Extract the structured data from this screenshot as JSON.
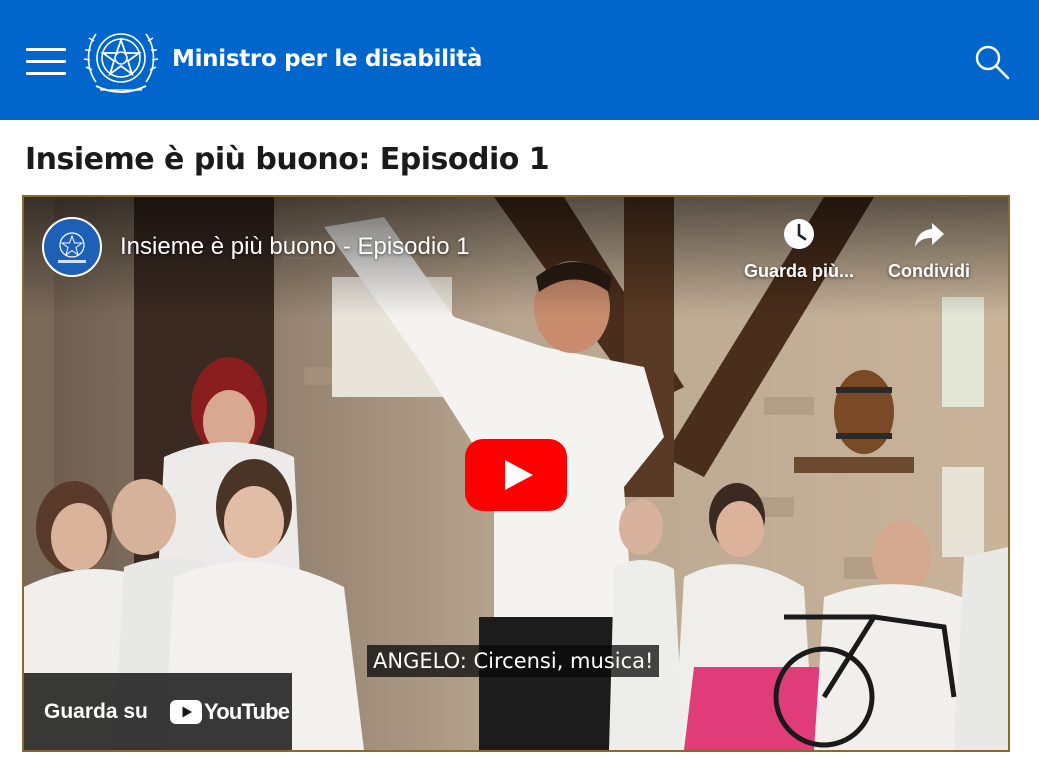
{
  "header": {
    "site_title": "Ministro per le disabilità",
    "menu_icon": "hamburger-menu-icon",
    "search_icon": "search-icon",
    "background_color": "#0066cc"
  },
  "page": {
    "title": "Insieme è più buono: Episodio 1"
  },
  "video": {
    "title": "Insieme è più buono - Episodio 1",
    "watch_later_label": "Guarda più...",
    "share_label": "Condividi",
    "caption": "ANGELO: Circensi, musica!",
    "watch_on_label": "Guarda su",
    "youtube_logo_text": "YouTube",
    "play_button_color": "#ff0000",
    "icons": {
      "watch_later": "clock-icon",
      "share": "share-arrow-icon",
      "play": "play-icon",
      "youtube": "youtube-logo-icon"
    }
  }
}
